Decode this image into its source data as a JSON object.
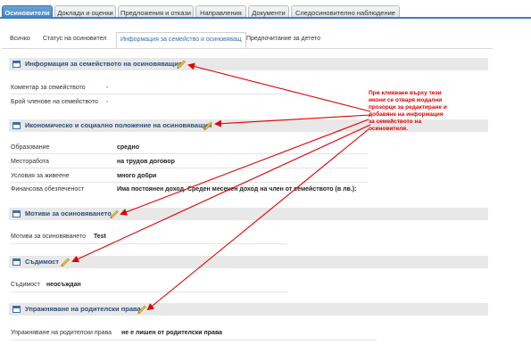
{
  "top_tabs": [
    {
      "label": "Осиновители",
      "active": true
    },
    {
      "label": "Доклади и оценки",
      "active": false
    },
    {
      "label": "Предложения и откази",
      "active": false
    },
    {
      "label": "Направления",
      "active": false
    },
    {
      "label": "Документи",
      "active": false
    },
    {
      "label": "Следосиновително наблюдение",
      "active": false
    }
  ],
  "sub_tabs": [
    {
      "label": "Всичко",
      "active": false
    },
    {
      "label": "Статус на осиновител",
      "active": false
    },
    {
      "label": "Информация за семейство и осиновяващ",
      "active": true
    },
    {
      "label": "Предпочитание за детето",
      "active": false
    }
  ],
  "sections": {
    "family": {
      "title": "Информация за семейството на осиновяващия",
      "rows": [
        {
          "label": "Коментар за семейството",
          "value": "-"
        },
        {
          "label": "Брой членове на семейството",
          "value": "-"
        }
      ]
    },
    "economic": {
      "title": "Икономическо и социално положение на осиновяващия",
      "rows": [
        {
          "label": "Образование",
          "value": "средно"
        },
        {
          "label": "Месторабота",
          "value": "на трудов договор"
        },
        {
          "label": "Условия за живеене",
          "value": "много добри"
        },
        {
          "label": "Финансова обезпеченост",
          "value": "Има постоянен доход. Среден месечен доход на член от семейството (в лв.):"
        }
      ]
    },
    "motives": {
      "title": "Мотиви за осиновяването",
      "rows": [
        {
          "label": "Мотиви за осиновяването",
          "value": "Test"
        }
      ]
    },
    "criminal": {
      "title": "Съдимост",
      "rows": [
        {
          "label": "Съдимост",
          "value": "неосъждан"
        }
      ]
    },
    "parental": {
      "title": "Упражняване на родителски права",
      "rows": [
        {
          "label": "Упражняване на родителски права",
          "value": "не е лишен от родителски права"
        }
      ]
    }
  },
  "annotation": "При кликване върху тези икони се отваря модални прозорци за редактиране и добавяне на информация за семейството на осиновителя.",
  "colors": {
    "accent": "#3e7fbf",
    "section_bg": "#e8e8e8",
    "annotation": "#e00000"
  },
  "icons": {
    "section": "window-icon",
    "edit": "pencil-icon"
  }
}
